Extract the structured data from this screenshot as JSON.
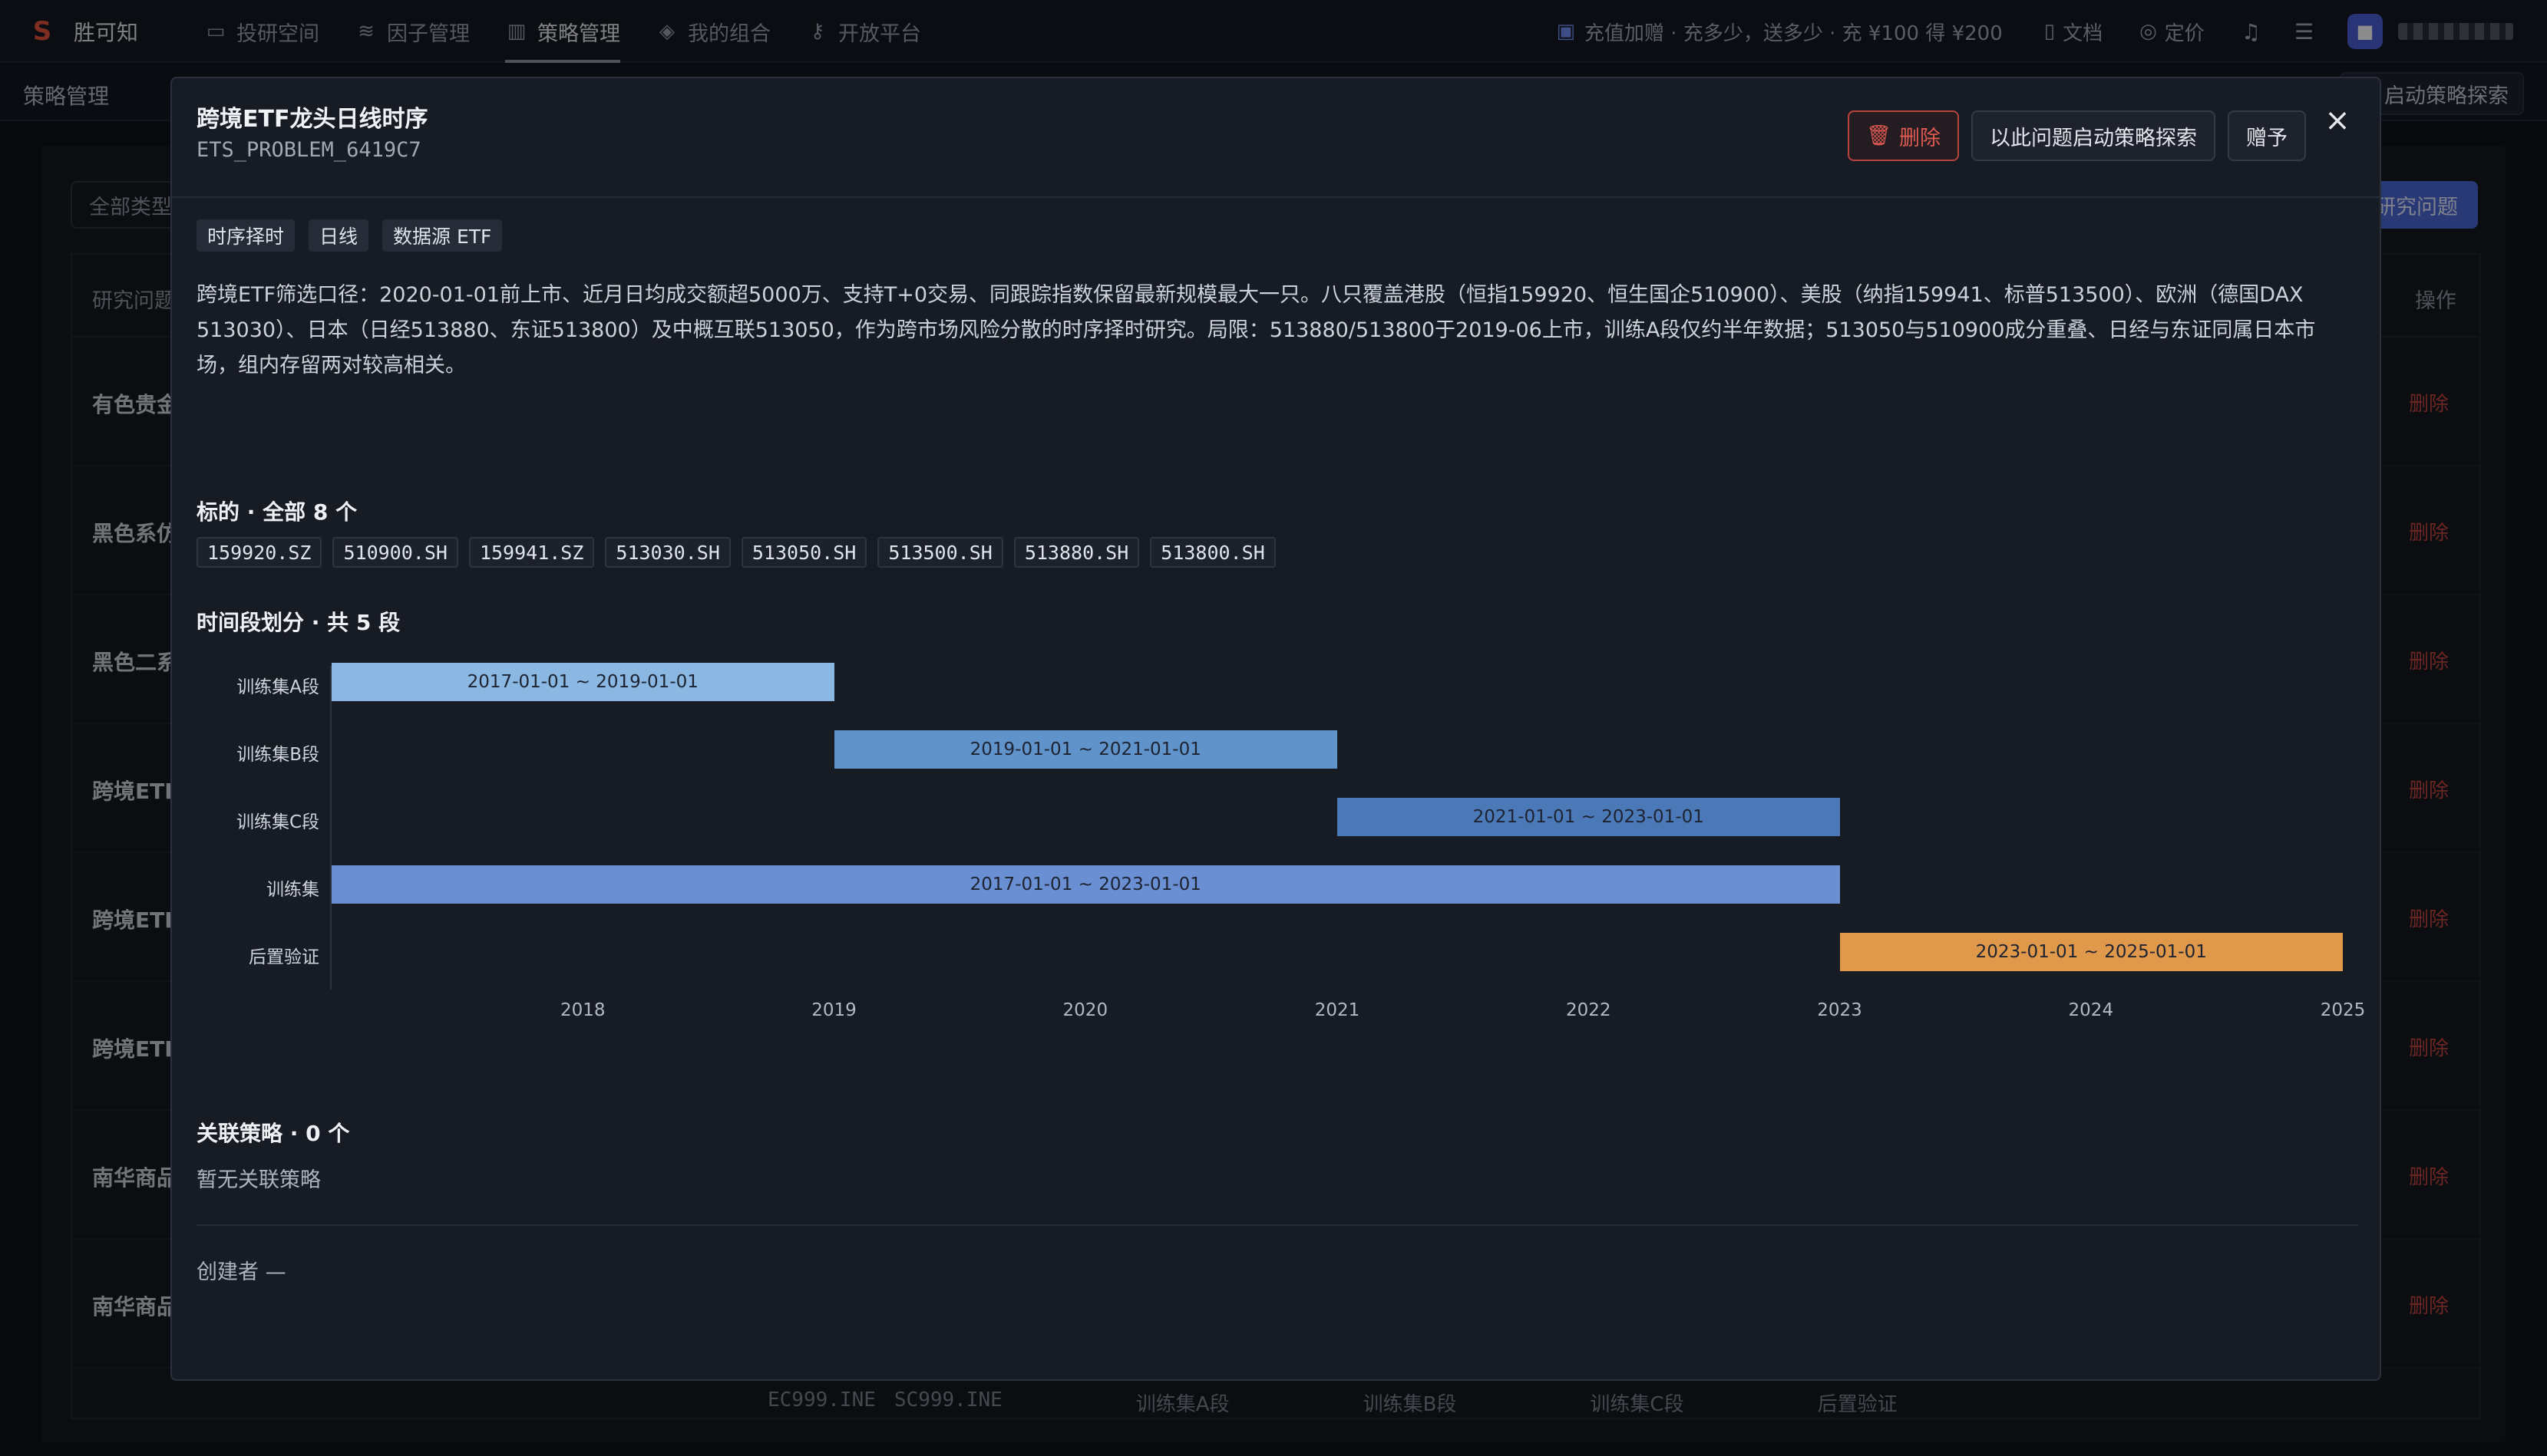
{
  "app": {
    "logo": "S",
    "name": "胜可知"
  },
  "nav": [
    {
      "label": "投研空间",
      "icon": "chat-square-icon",
      "active": false
    },
    {
      "label": "因子管理",
      "icon": "database-icon",
      "active": false
    },
    {
      "label": "策略管理",
      "icon": "bar-chart-icon",
      "active": true
    },
    {
      "label": "我的组合",
      "icon": "cube-icon",
      "active": false
    },
    {
      "label": "开放平台",
      "icon": "key-icon",
      "active": false
    }
  ],
  "topright": {
    "promo": "充值加赠 · 充多少，送多少 · 充 ¥100 得 ¥200",
    "docs": "文档",
    "pricing": "定价"
  },
  "background": {
    "page_title": "策略管理",
    "start_button": "启动策略探索",
    "filter": "全部类型",
    "new_button": "研究问题",
    "col_name": "研究问题",
    "col_op": "操作",
    "rows": [
      "有色贵金",
      "黑色系仿",
      "黑色二系",
      "跨境ETF",
      "跨境ETF",
      "跨境ETF",
      "南华商品",
      "南华商品"
    ],
    "delete_label": "删除",
    "footer": {
      "code1": "EC999.INE",
      "code2": "SC999.INE",
      "p1": "训练集A段",
      "p2": "训练集B段",
      "p3": "训练集C段",
      "p4": "后置验证"
    }
  },
  "modal": {
    "title": "跨境ETF龙头日线时序",
    "id": "ETS_PROBLEM_6419C7",
    "delete_button": "删除",
    "explore_button": "以此问题启动策略探索",
    "gift_button": "赠予",
    "tags": [
      "时序择时",
      "日线",
      "数据源 ETF"
    ],
    "description": "跨境ETF筛选口径：2020-01-01前上市、近月日均成交额超5000万、支持T+0交易、同跟踪指数保留最新规模最大一只。八只覆盖港股（恒指159920、恒生国企510900）、美股（纳指159941、标普513500）、欧洲（德国DAX 513030）、日本（日经513880、东证513800）及中概互联513050，作为跨市场风险分散的时序择时研究。局限：513880/513800于2019-06上市，训练A段仅约半年数据；513050与510900成分重叠、日经与东证同属日本市场，组内存留两对较高相关。",
    "assets_title": "标的 · 全部 8 个",
    "assets": [
      "159920.SZ",
      "510900.SH",
      "159941.SZ",
      "513030.SH",
      "513050.SH",
      "513500.SH",
      "513880.SH",
      "513800.SH"
    ],
    "periods_title": "时间段划分 · 共 5 段",
    "linked_title": "关联策略 · 0 个",
    "linked_empty": "暂无关联策略",
    "creator": "创建者 —"
  },
  "chart_data": {
    "type": "gantt",
    "x_ticks": [
      "2018",
      "2019",
      "2020",
      "2021",
      "2022",
      "2023",
      "2024",
      "2025"
    ],
    "xlim": [
      "2017-01-01",
      "2025-01-01"
    ],
    "segments": [
      {
        "name": "训练集A段",
        "start": "2017-01-01",
        "end": "2019-01-01",
        "label": "2017-01-01 ~ 2019-01-01",
        "color": "#8ab8e3"
      },
      {
        "name": "训练集B段",
        "start": "2019-01-01",
        "end": "2021-01-01",
        "label": "2019-01-01 ~ 2021-01-01",
        "color": "#5f93c9"
      },
      {
        "name": "训练集C段",
        "start": "2021-01-01",
        "end": "2023-01-01",
        "label": "2021-01-01 ~ 2023-01-01",
        "color": "#4b79b7"
      },
      {
        "name": "训练集",
        "start": "2017-01-01",
        "end": "2023-01-01",
        "label": "2017-01-01 ~ 2023-01-01",
        "color": "#6a8fd3"
      },
      {
        "name": "后置验证",
        "start": "2023-01-01",
        "end": "2025-01-01",
        "label": "2023-01-01 ~ 2025-01-01",
        "color": "#e0994a"
      }
    ]
  }
}
